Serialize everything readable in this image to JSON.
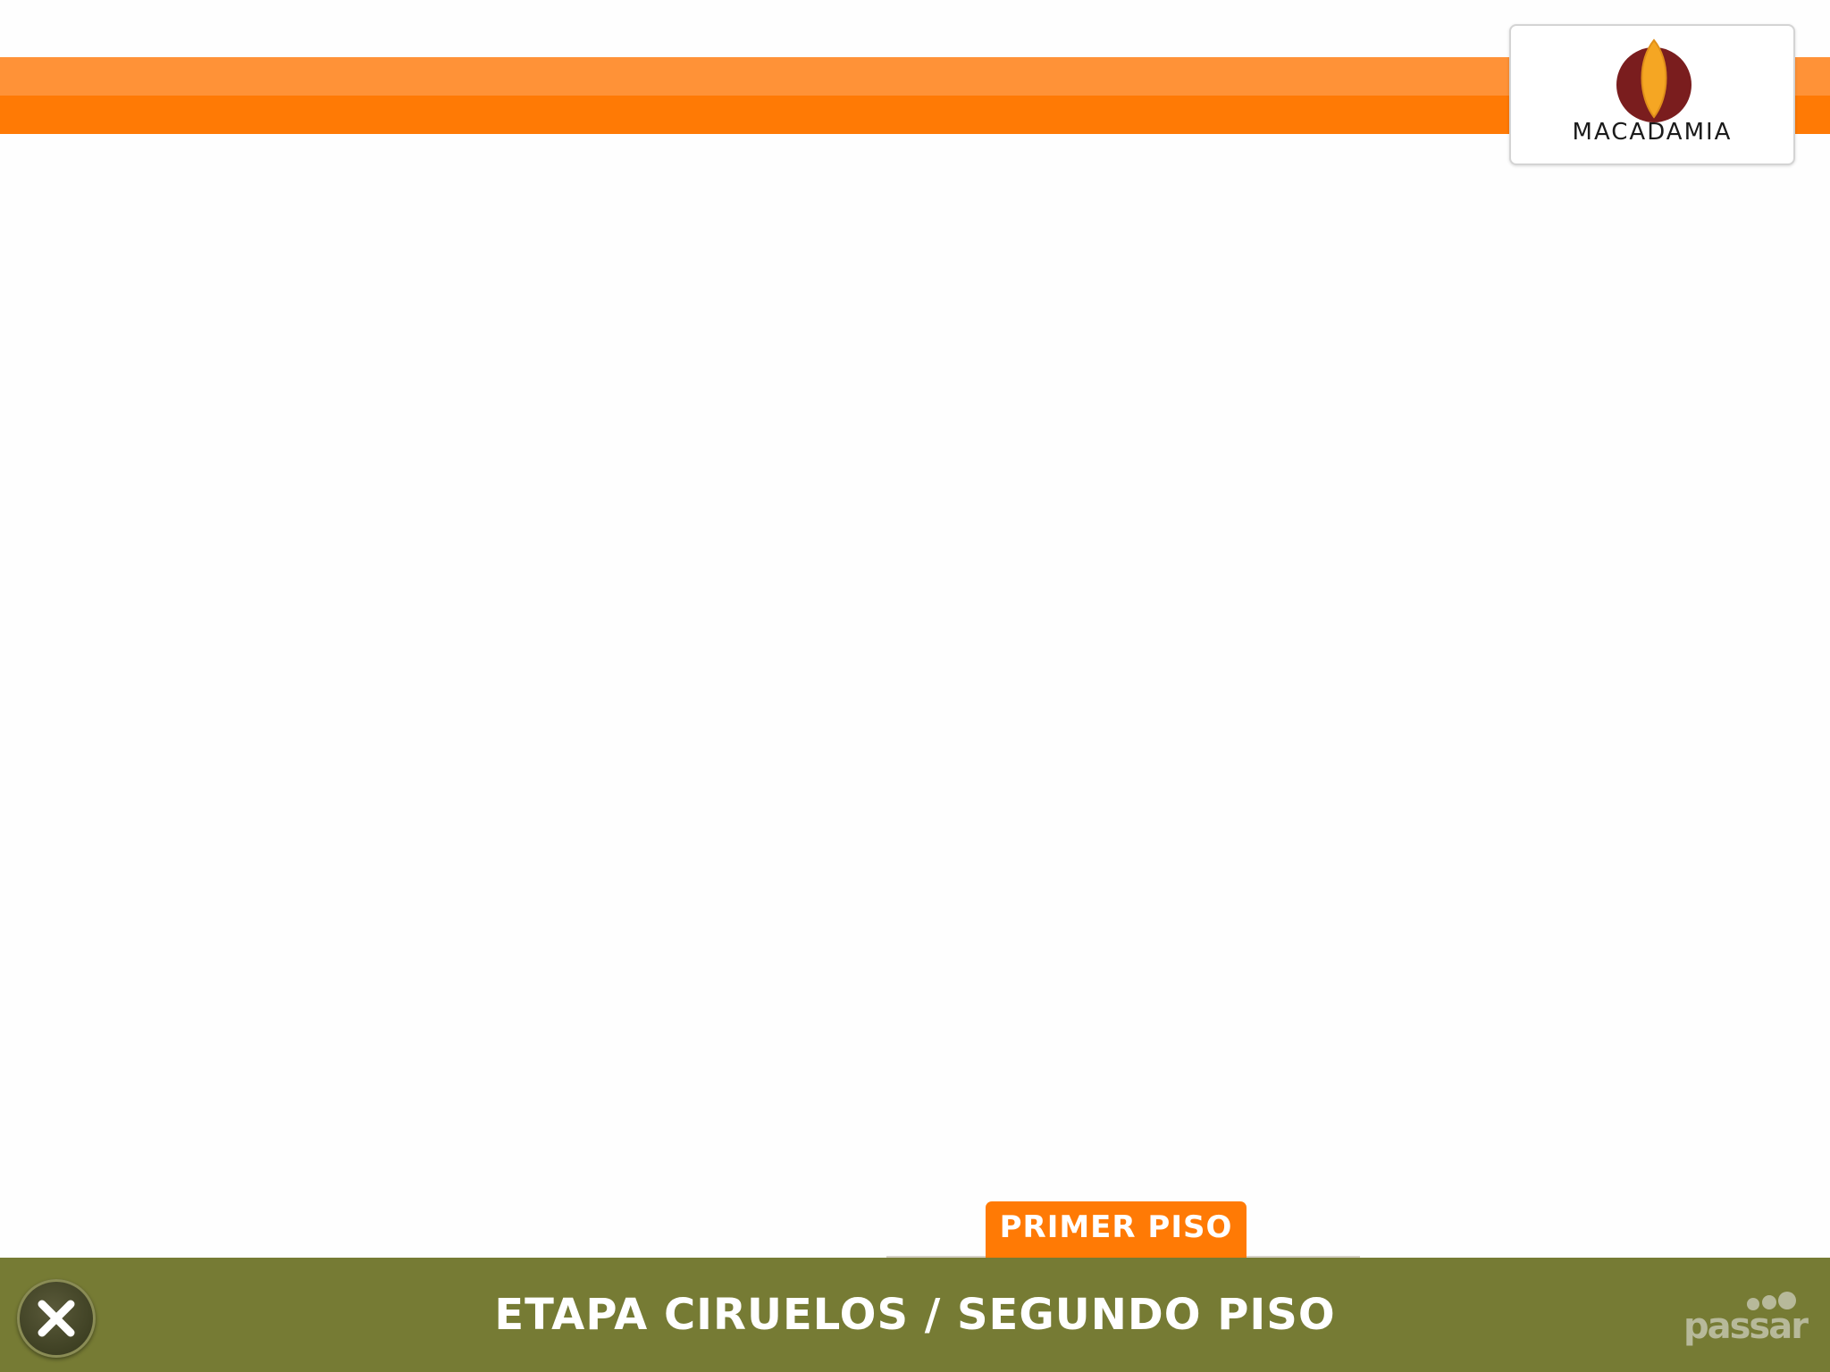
{
  "colors": {
    "orange_light": "#ff9237",
    "orange_dark": "#ff7a05",
    "bottom_bar": "#767b34",
    "logo_maroon": "#7a1d1e",
    "logo_gold": "#f5a623"
  },
  "logo": {
    "text": "MACADAMIA",
    "icon": "macadamia-leaf-icon"
  },
  "floor_tab": {
    "label": "PRIMER PISO"
  },
  "bottom_bar": {
    "title": "ETAPA CIRUELOS / SEGUNDO PISO",
    "close_icon": "close-icon",
    "brand": "passar"
  }
}
